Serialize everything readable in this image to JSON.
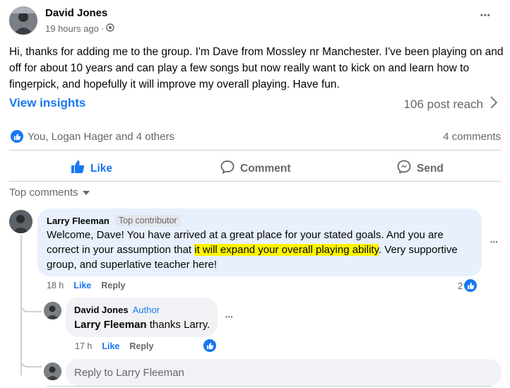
{
  "post": {
    "author": "David Jones",
    "time": "19 hours ago",
    "separator": "·",
    "text": "Hi, thanks for adding me to the group. I'm Dave from Mossley nr Manchester. I've been playing on and off for about 10 years and can play a few songs but now really want to kick on and learn how to fingerpick, and hopefully it will improve my overall playing. Have fun.",
    "more": "•••"
  },
  "insights": {
    "label": "View insights",
    "reach": "106 post reach"
  },
  "reactions": {
    "summary": "You, Logan Hager and 4 others",
    "comments": "4 comments"
  },
  "actions": {
    "like": "Like",
    "comment": "Comment",
    "send": "Send"
  },
  "top_comments": "Top comments",
  "comment1": {
    "name": "Larry Fleeman",
    "badge": "Top contributor",
    "text_before": "Welcome, Dave! You have arrived at a great place for your stated goals. And you are correct in your assumption that ",
    "text_highlight": "it will expand your overall playing ability",
    "text_after": ". Very supportive group, and superlative teacher here!",
    "time": "18 h",
    "like": "Like",
    "reply": "Reply",
    "reaction_count": "2",
    "more": "•••"
  },
  "reply1": {
    "name": "David Jones",
    "badge": "Author",
    "mention": "Larry Fleeman",
    "text": " thanks Larry.",
    "time": "17 h",
    "like": "Like",
    "reply": "Reply",
    "more": "•••"
  },
  "reply_box": {
    "placeholder": "Reply to Larry Fleeman"
  },
  "colors": {
    "accent": "#1877f2",
    "highlight": "#fff500",
    "bubble_blue": "#e7f0fc",
    "bubble_grey": "#f0f2f5"
  }
}
